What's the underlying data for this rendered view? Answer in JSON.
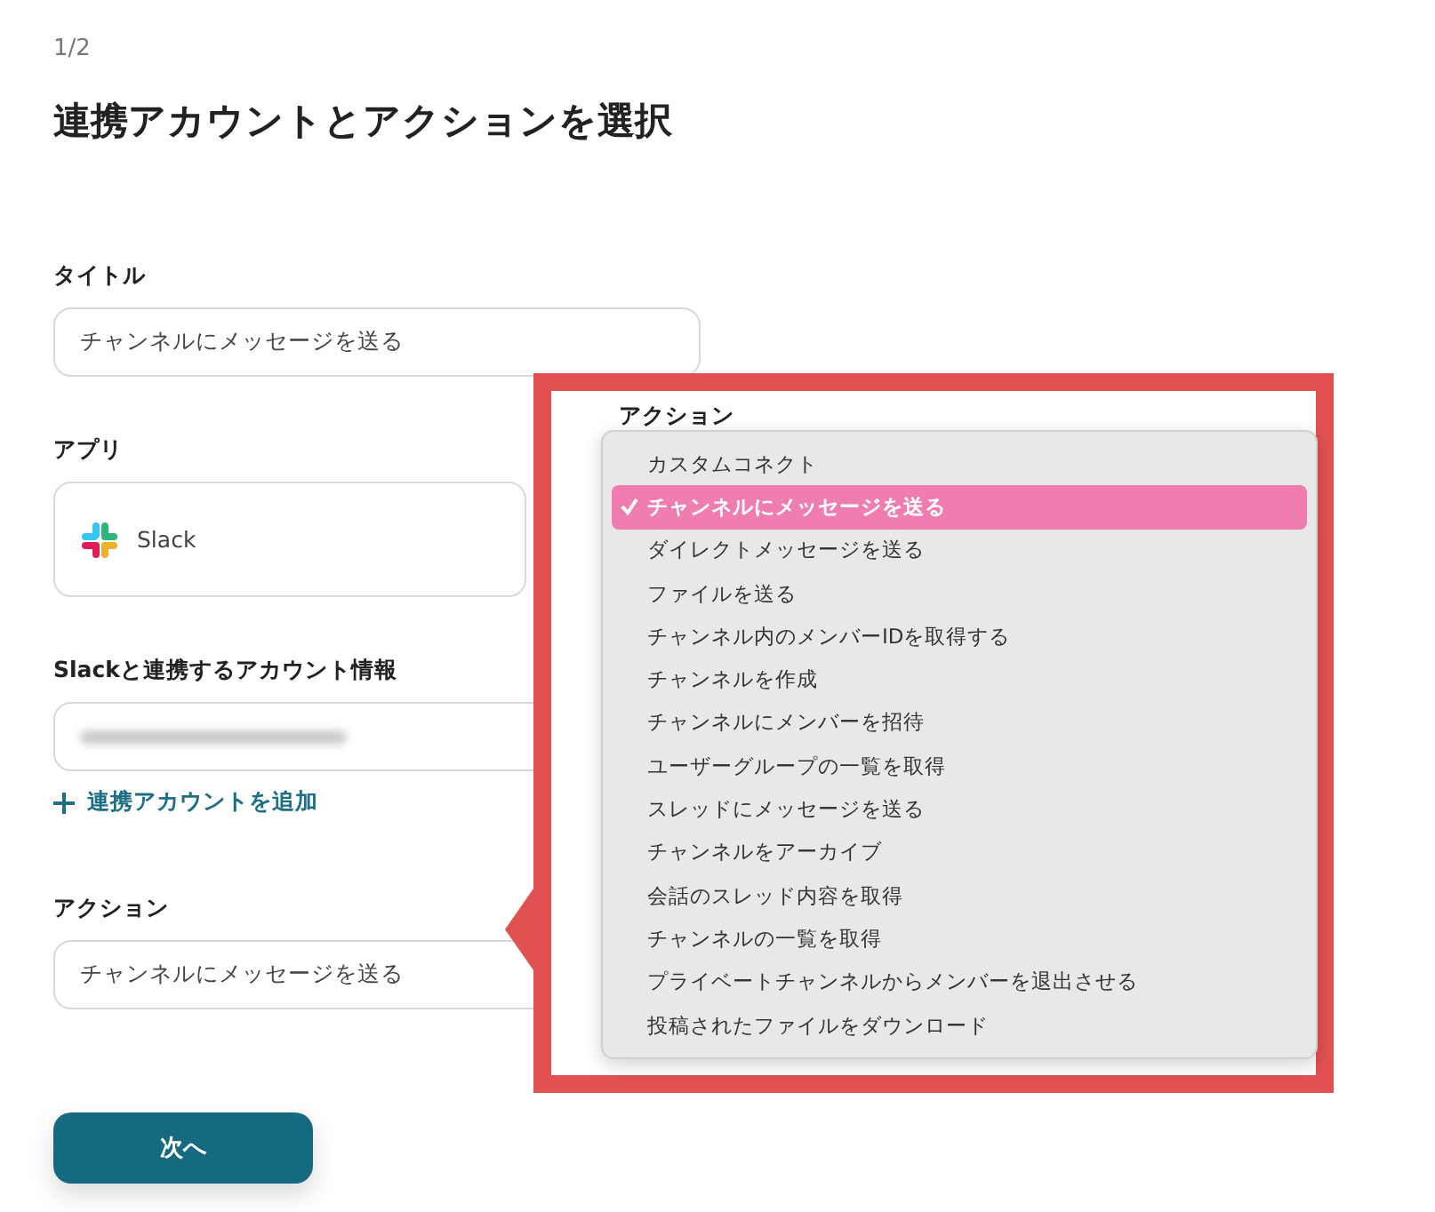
{
  "step": "1/2",
  "heading": "連携アカウントとアクションを選択",
  "fields": [
    {
      "kind": "text",
      "label": "タイトル",
      "value": "チャンネルにメッセージを送る"
    },
    {
      "kind": "app",
      "label": "アプリ",
      "value": "Slack"
    },
    {
      "kind": "account",
      "label": "Slackと連携するアカウント情報",
      "link": "連携アカウントを追加"
    },
    {
      "kind": "text",
      "label": "アクション",
      "value": "チャンネルにメッセージを送る"
    }
  ],
  "next_button": "次へ",
  "callout": {
    "label": "アクション",
    "menu": [
      {
        "label": "カスタムコネクト",
        "selected": false
      },
      {
        "label": "チャンネルにメッセージを送る",
        "selected": true
      },
      {
        "label": "ダイレクトメッセージを送る",
        "selected": false
      },
      {
        "label": "ファイルを送る",
        "selected": false
      },
      {
        "label": "チャンネル内のメンバーIDを取得する",
        "selected": false
      },
      {
        "label": "チャンネルを作成",
        "selected": false
      },
      {
        "label": "チャンネルにメンバーを招待",
        "selected": false
      },
      {
        "label": "ユーザーグループの一覧を取得",
        "selected": false
      },
      {
        "label": "スレッドにメッセージを送る",
        "selected": false
      },
      {
        "label": "チャンネルをアーカイブ",
        "selected": false
      },
      {
        "label": "会話のスレッド内容を取得",
        "selected": false
      },
      {
        "label": "チャンネルの一覧を取得",
        "selected": false
      },
      {
        "label": "プライベートチャンネルからメンバーを退出させる",
        "selected": false
      },
      {
        "label": "投稿されたファイルをダウンロード",
        "selected": false
      }
    ]
  }
}
